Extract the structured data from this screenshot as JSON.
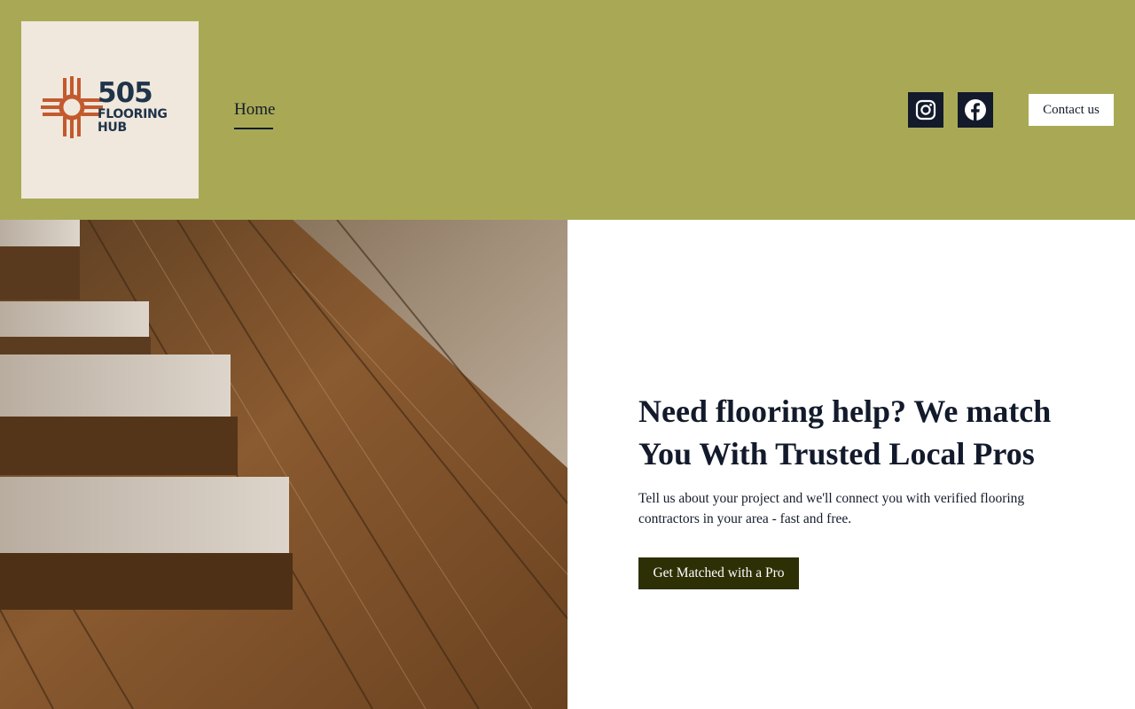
{
  "logo": {
    "number": "505",
    "word_line1": "FLOORING",
    "word_line2": "HUB",
    "symbol": "zia-sun-symbol"
  },
  "nav": {
    "items": [
      {
        "label": "Home",
        "active": true
      }
    ]
  },
  "social": {
    "instagram_icon": "instagram-icon",
    "facebook_icon": "facebook-icon"
  },
  "header": {
    "contact_label": "Contact us"
  },
  "hero": {
    "title": "Need flooring help? We match You With Trusted Local Pros",
    "subtitle": "Tell us about your project and we'll connect you with verified flooring contractors in your area - fast and free.",
    "cta_label": "Get Matched with a Pro",
    "image": "wood-floor-planks-photo"
  },
  "colors": {
    "header_bg": "#a9a955",
    "logo_bg": "#f0e8dd",
    "logo_text": "#1f3349",
    "logo_symbol": "#c35a2e",
    "social_bg": "#121a2b",
    "cta_bg": "#2d2f05",
    "text_dark": "#141b2b"
  }
}
